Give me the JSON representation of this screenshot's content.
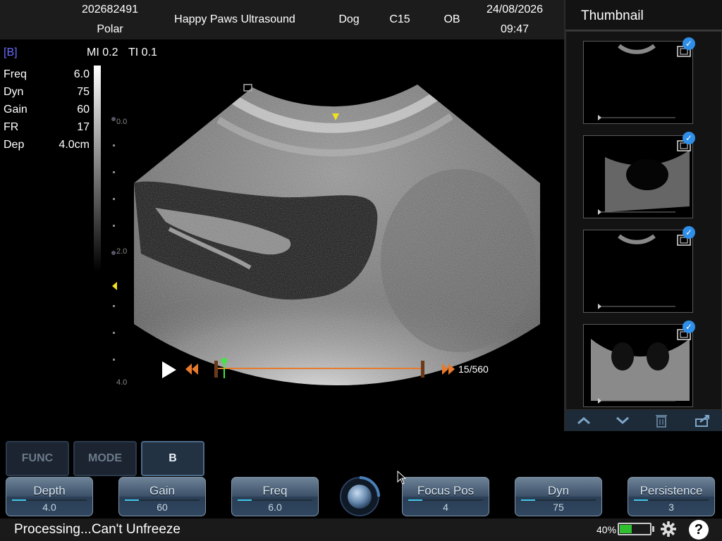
{
  "header": {
    "patient_id": "202682491",
    "patient_name": "Polar",
    "hospital": "Happy Paws Ultrasound",
    "species": "Dog",
    "probe": "C15",
    "exam": "OB",
    "date": "24/08/2026",
    "time": "09:47"
  },
  "image_info": {
    "mode_tag": "[B]",
    "mi": "MI 0.2",
    "ti": "TI 0.1",
    "params": [
      {
        "label": "Freq",
        "value": "6.0"
      },
      {
        "label": "Dyn",
        "value": "75"
      },
      {
        "label": "Gain",
        "value": "60"
      },
      {
        "label": "FR",
        "value": "17"
      },
      {
        "label": "Dep",
        "value": "4.0cm"
      }
    ],
    "depth_labels": [
      "0.0",
      "2.0",
      "4.0"
    ]
  },
  "cine": {
    "frame_counter": "15/560",
    "current_frame": 15,
    "total_frames": 560
  },
  "thumbnails": {
    "title": "Thumbnail",
    "items": [
      {
        "selected": true,
        "kind": "clip"
      },
      {
        "selected": true,
        "kind": "clip"
      },
      {
        "selected": true,
        "kind": "clip"
      },
      {
        "selected": true,
        "kind": "clip"
      }
    ]
  },
  "mode_buttons": [
    {
      "label": "FUNC",
      "active": false
    },
    {
      "label": "MODE",
      "active": false
    },
    {
      "label": "B",
      "active": true
    }
  ],
  "controls": [
    {
      "label": "Depth",
      "value": "4.0"
    },
    {
      "label": "Gain",
      "value": "60"
    },
    {
      "label": "Freq",
      "value": "6.0"
    },
    {
      "label": "Focus Pos",
      "value": "4"
    },
    {
      "label": "Dyn",
      "value": "75"
    },
    {
      "label": "Persistence",
      "value": "3"
    }
  ],
  "status": {
    "message": "Processing...Can't Unfreeze",
    "battery": "40%",
    "battery_level": 0.4,
    "help": "?"
  },
  "colors": {
    "accent_orange": "#e87a2c",
    "check_blue": "#2f8ee8",
    "control_fill_cyan": "#3fc6e8",
    "battery_green": "#2fbf2f",
    "mode_tag": "#6b6bff"
  }
}
